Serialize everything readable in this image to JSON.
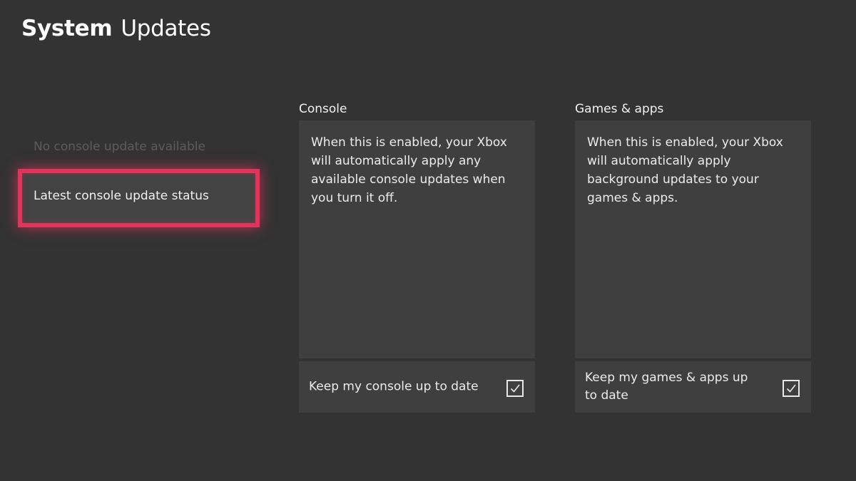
{
  "page": {
    "title_strong": "System",
    "title_light": "Updates"
  },
  "menu": {
    "items": [
      {
        "label": "No console update available",
        "state": "disabled"
      },
      {
        "label": "Latest console update status",
        "state": "focused"
      }
    ]
  },
  "columns": [
    {
      "heading": "Console",
      "description": "When this is enabled, your Xbox will automatically apply any available console updates when you turn it off.",
      "toggle": {
        "label": "Keep my console up to date",
        "checked": true
      }
    },
    {
      "heading": "Games & apps",
      "description": "When this is enabled, your Xbox will automatically apply background updates to your games & apps.",
      "toggle": {
        "label": "Keep my games & apps up to date",
        "checked": true
      }
    }
  ],
  "colors": {
    "background": "#333333",
    "panel": "#3f3f3f",
    "focus_border": "#e2335a",
    "disabled_text": "#5c5c5c"
  },
  "icons": {
    "checkbox": "checkmark-icon"
  }
}
